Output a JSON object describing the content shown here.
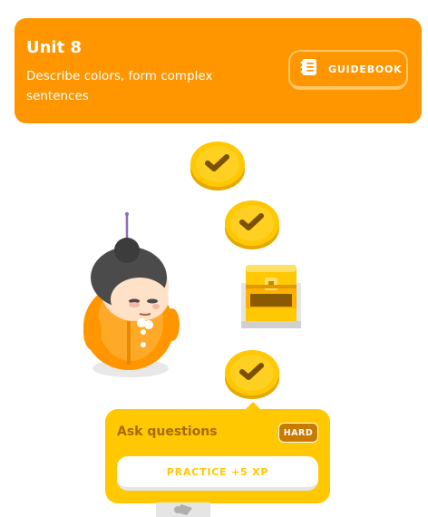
{
  "unit": {
    "title": "Unit 8",
    "description": "Describe colors, form complex sentences",
    "guidebook_label": "GUIDEBOOK",
    "color": "#ff9600"
  },
  "path": {
    "nodes": [
      {
        "status": "completed",
        "icon": "check-icon"
      },
      {
        "status": "completed",
        "icon": "check-icon"
      },
      {
        "status": "completed",
        "icon": "check-icon"
      }
    ],
    "chest": {
      "status": "completed",
      "icon": "treasure-chest-icon"
    },
    "character": {
      "icon": "grandma-character"
    }
  },
  "popup": {
    "title": "Ask questions",
    "badge": "HARD",
    "button_label": "PRACTICE +5 XP",
    "color": "#ffc800"
  }
}
